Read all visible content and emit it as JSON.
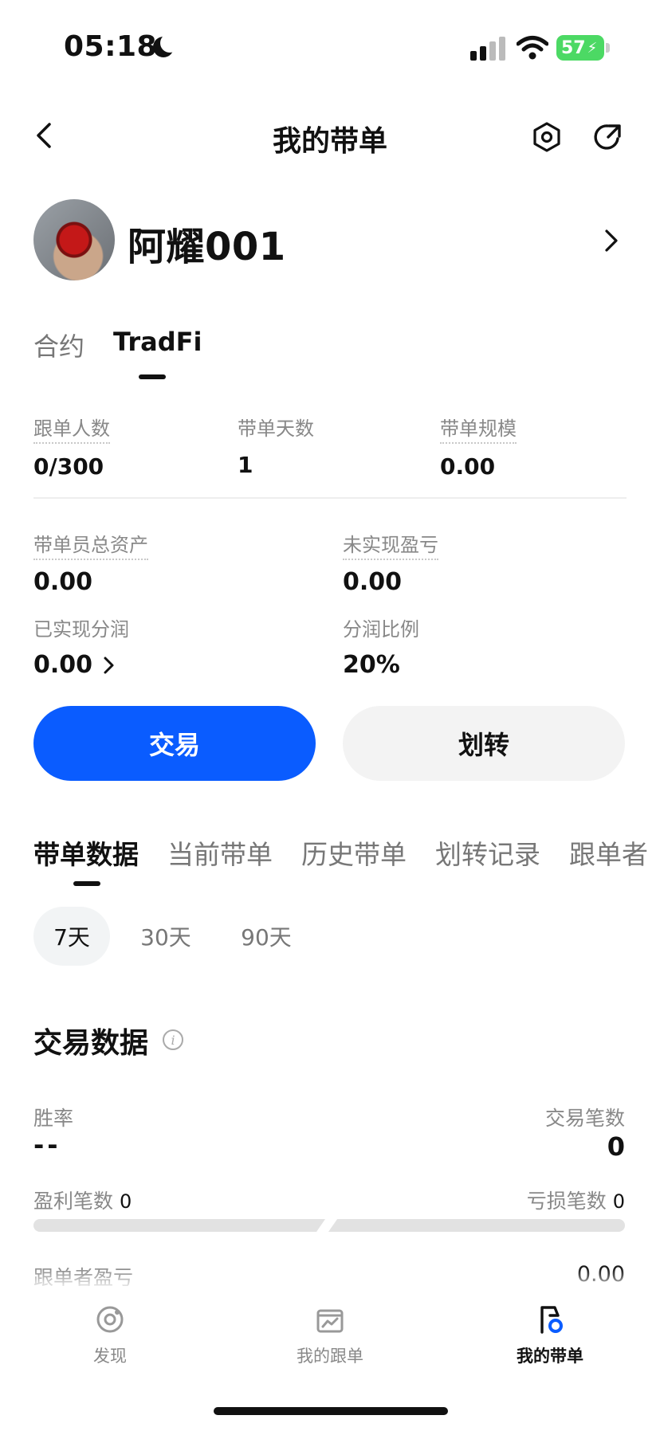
{
  "status_bar": {
    "time": "05:18",
    "battery": "57"
  },
  "header": {
    "title": "我的带单"
  },
  "profile": {
    "username": "阿耀001"
  },
  "product_tabs": [
    {
      "label": "合约",
      "active": false
    },
    {
      "label": "TradFi",
      "active": true
    }
  ],
  "stats_row1": [
    {
      "label": "跟单人数",
      "value": "0/300"
    },
    {
      "label": "带单天数",
      "value": "1"
    },
    {
      "label": "带单规模",
      "value": "0.00"
    }
  ],
  "stats_row2": [
    {
      "label": "带单员总资产",
      "value": "0.00"
    },
    {
      "label": "未实现盈亏",
      "value": "0.00"
    }
  ],
  "stats_row3": [
    {
      "label": "已实现分润",
      "value": "0.00"
    },
    {
      "label": "分润比例",
      "value": "20%"
    }
  ],
  "actions": {
    "trade": "交易",
    "transfer": "划转"
  },
  "section_tabs": [
    {
      "label": "带单数据",
      "active": true
    },
    {
      "label": "当前带单",
      "active": false
    },
    {
      "label": "历史带单",
      "active": false
    },
    {
      "label": "划转记录",
      "active": false
    },
    {
      "label": "跟单者",
      "active": false
    }
  ],
  "period_chips": [
    {
      "label": "7天",
      "active": true
    },
    {
      "label": "30天",
      "active": false
    },
    {
      "label": "90天",
      "active": false
    }
  ],
  "trade_data": {
    "title": "交易数据",
    "win_rate_label": "胜率",
    "win_rate_value": "--",
    "trade_count_label": "交易笔数",
    "trade_count_value": "0",
    "profit_count_label": "盈利笔数",
    "profit_count_value": "0",
    "loss_count_label": "亏损笔数",
    "loss_count_value": "0",
    "follower_pnl_label": "跟单者盈亏",
    "follower_pnl_value": "0.00"
  },
  "bottom_nav": [
    {
      "label": "发现",
      "icon": "discover-icon",
      "active": false
    },
    {
      "label": "我的跟单",
      "icon": "chart-icon",
      "active": false
    },
    {
      "label": "我的带单",
      "icon": "flag-icon",
      "active": true
    }
  ],
  "colors": {
    "accent": "#0a5cff",
    "secondary_button": "#f3f3f3",
    "battery": "#4cd964"
  }
}
